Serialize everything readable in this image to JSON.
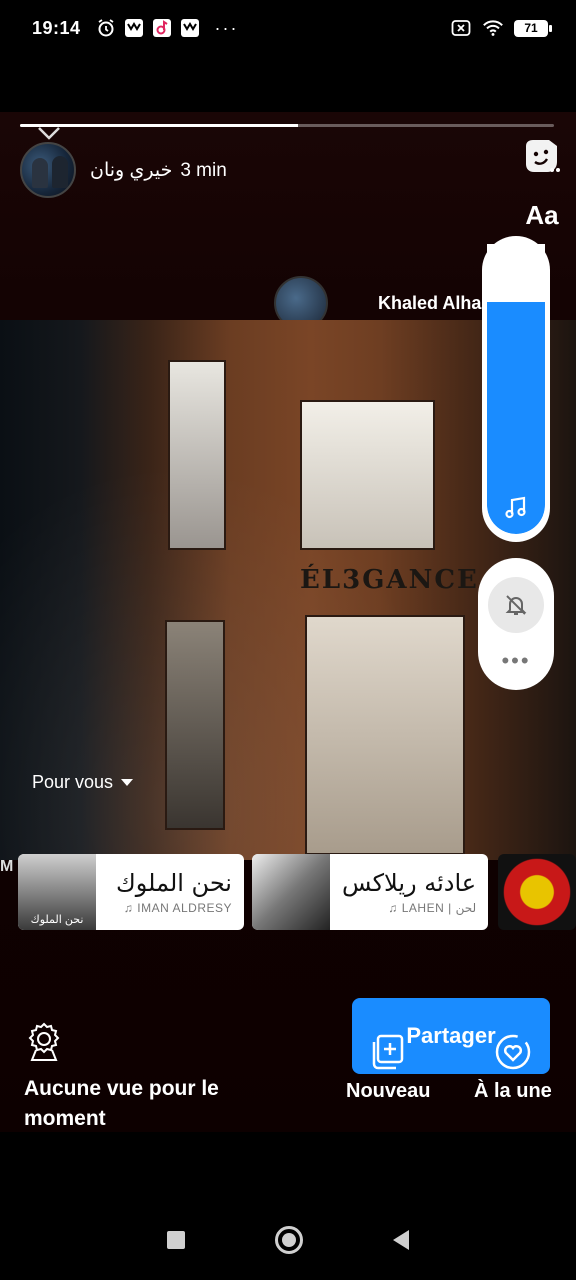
{
  "status_bar": {
    "time": "19:14",
    "battery": "71",
    "more": "···"
  },
  "story": {
    "progress_fraction": 0.52,
    "user_name": "خيري ونان",
    "time_ago": "3 min",
    "text_tool_label": "Aa"
  },
  "post": {
    "author": "Khaled Alha",
    "sign_text": "ÉL3GANCE",
    "feed_selector": "Pour vous"
  },
  "tracks": [
    {
      "title": "نحن الملوك",
      "artist": "IMAN ALDRESY",
      "thumb_caption": "نحن الملوك"
    },
    {
      "title": "عادئه ريلاكس",
      "artist": "LAHEN | لحن"
    }
  ],
  "volume": {
    "level": 0.8
  },
  "bottom": {
    "share_label": "Partager",
    "views_text": "Aucune vue pour le moment",
    "new_label": "Nouveau",
    "highlight_label": "À la une"
  },
  "colors": {
    "accent": "#1a8cff",
    "story_bg": "#140303"
  }
}
